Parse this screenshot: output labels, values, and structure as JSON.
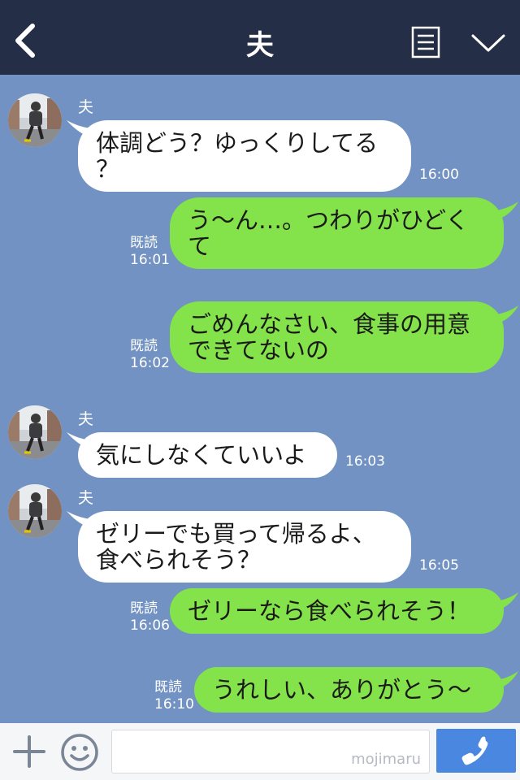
{
  "header": {
    "title": "夫",
    "icons": {
      "back": "chevron-left-icon",
      "menu": "menu-list-icon",
      "collapse": "chevron-down-icon"
    }
  },
  "messages": [
    {
      "sender": "夫",
      "side": "in",
      "lines": [
        "体調どう？ゆっくりしてる",
        "？"
      ],
      "time": "16:00"
    },
    {
      "side": "out",
      "read": "既読",
      "lines": [
        "う〜ん…。つわりがひどく",
        "て"
      ],
      "time": "16:01"
    },
    {
      "side": "out",
      "read": "既読",
      "lines": [
        "ごめんなさい、食事の用意",
        "できてないの"
      ],
      "time": "16:02"
    },
    {
      "sender": "夫",
      "side": "in",
      "lines": [
        "気にしなくていいよ"
      ],
      "time": "16:03"
    },
    {
      "sender": "夫",
      "side": "in",
      "lines": [
        "ゼリーでも買って帰るよ、",
        "食べられそう？"
      ],
      "time": "16:05"
    },
    {
      "side": "out",
      "read": "既読",
      "lines": [
        "ゼリーなら食べられそう！"
      ],
      "time": "16:06"
    },
    {
      "side": "out",
      "read": "既読",
      "lines": [
        "うれしい、ありがとう〜"
      ],
      "time": "16:10"
    }
  ],
  "footer": {
    "input_value": "",
    "watermark": "mojimaru",
    "icons": {
      "plus": "plus-icon",
      "sticker": "smiley-icon",
      "call": "phone-icon"
    }
  },
  "colors": {
    "header_bg": "#242e46",
    "chat_bg": "#7192c2",
    "incoming_bubble": "#ffffff",
    "outgoing_bubble": "#84e24a",
    "call_button": "#4a87e0"
  }
}
